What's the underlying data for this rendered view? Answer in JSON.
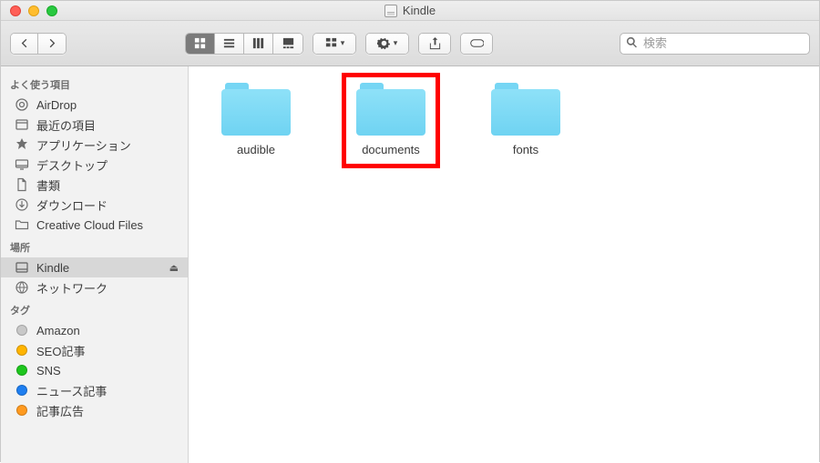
{
  "window": {
    "title": "Kindle"
  },
  "search": {
    "placeholder": "検索"
  },
  "sidebar": {
    "sections": {
      "favorites": {
        "title": "よく使う項目",
        "items": [
          {
            "label": "AirDrop"
          },
          {
            "label": "最近の項目"
          },
          {
            "label": "アプリケーション"
          },
          {
            "label": "デスクトップ"
          },
          {
            "label": "書類"
          },
          {
            "label": "ダウンロード"
          },
          {
            "label": "Creative Cloud Files"
          }
        ]
      },
      "locations": {
        "title": "場所",
        "items": [
          {
            "label": "Kindle",
            "selected": true,
            "ejectable": true
          },
          {
            "label": "ネットワーク"
          }
        ]
      },
      "tags": {
        "title": "タグ",
        "items": [
          {
            "label": "Amazon",
            "color": "#c8c8c8"
          },
          {
            "label": "SEO記事",
            "color": "#ffb400"
          },
          {
            "label": "SNS",
            "color": "#1ec61e"
          },
          {
            "label": "ニュース記事",
            "color": "#1e7ef0"
          },
          {
            "label": "記事広告",
            "color": "#ff9a1f"
          }
        ]
      }
    }
  },
  "content": {
    "folders": [
      {
        "name": "audible",
        "highlighted": false
      },
      {
        "name": "documents",
        "highlighted": true
      },
      {
        "name": "fonts",
        "highlighted": false
      }
    ]
  }
}
